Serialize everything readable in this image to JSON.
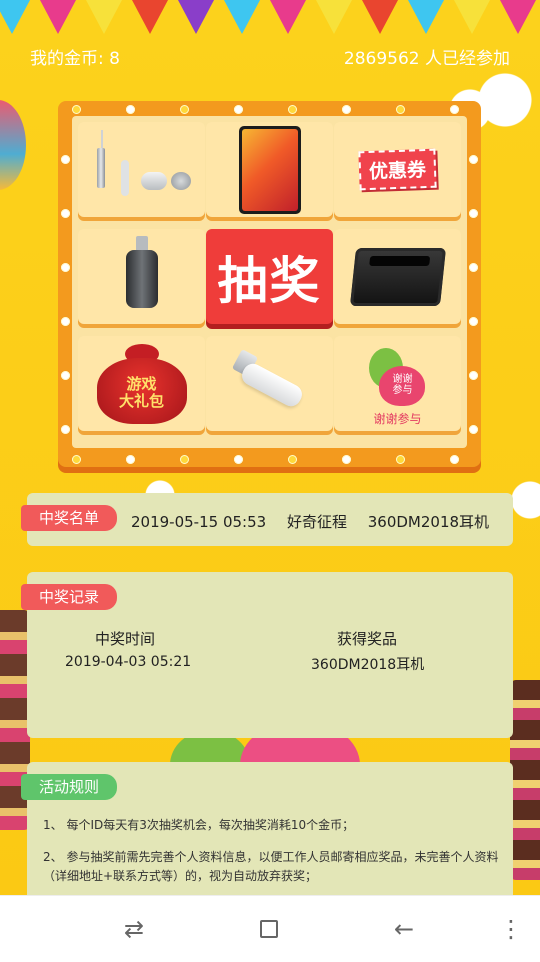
{
  "header": {
    "coins_text": "我的金币: 8",
    "participants_text": "2869562 人已经参加"
  },
  "bunting_colors": [
    "#3ec6f0",
    "#e83b8c",
    "#f7e13a",
    "#e9452f",
    "#8a3ec9",
    "#3ec6f0",
    "#e83b8c",
    "#f7e13a",
    "#e9452f",
    "#3ec6f0",
    "#f7e13a",
    "#e83b8c"
  ],
  "lottery": {
    "draw_label": "抽奖",
    "prizes": [
      {
        "icon": "earphones-icon"
      },
      {
        "icon": "phone-icon"
      },
      {
        "icon": "coupon-icon",
        "label": "优惠券"
      },
      {
        "icon": "usb-adapter-icon"
      },
      {
        "icon": "speaker-icon"
      },
      {
        "icon": "gift-bag-icon",
        "label": "游戏\n大礼包"
      },
      {
        "icon": "usb-c-adapter-icon"
      },
      {
        "icon": "thanks-icon",
        "label": "谢谢参与",
        "inner": "谢谢\n参与"
      }
    ]
  },
  "winners": {
    "tag": "中奖名单",
    "latest": {
      "time": "2019-05-15 05:53",
      "name": "好奇征程",
      "prize": "360DM2018耳机"
    }
  },
  "records": {
    "tag": "中奖记录",
    "columns": [
      "中奖时间",
      "获得奖品"
    ],
    "rows": [
      [
        "2019-04-03 05:21",
        "360DM2018耳机"
      ]
    ]
  },
  "rules": {
    "tag": "活动规则",
    "items": [
      "1、 每个ID每天有3次抽奖机会，每次抽奖消耗10个金币；",
      "2、 参与抽奖前需先完善个人资料信息，以便工作人员邮寄相应奖品，未完善个人资料（详细地址+联系方式等）的，视为自动放弃获奖；"
    ]
  },
  "navbar": {
    "back_icon": "back-icon",
    "home_icon": "recent-apps-icon",
    "switch_icon": "switch-icon",
    "menu_icon": "more-icon"
  },
  "colors": {
    "background": "#fcd21c",
    "board": "#f39a1e",
    "draw_button": "#ef3d3a",
    "tag_red": "#f15a5a",
    "tag_green": "#5fc56b",
    "panel": "#e3e6b7"
  }
}
